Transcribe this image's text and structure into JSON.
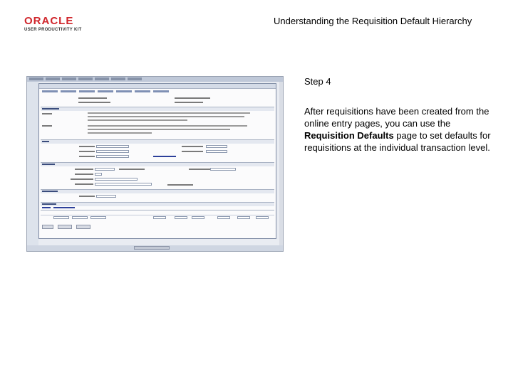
{
  "logo": {
    "brand": "ORACLE",
    "sub": "USER PRODUCTIVITY KIT"
  },
  "header": {
    "title": "Understanding the Requisition Default Hierarchy"
  },
  "content": {
    "step": "Step 4",
    "desc_before": "After requisitions have been created from the online entry pages, you can use the ",
    "desc_bold": "Requisition Defaults",
    "desc_after": " page to set defaults for requisitions at the individual transaction level."
  }
}
